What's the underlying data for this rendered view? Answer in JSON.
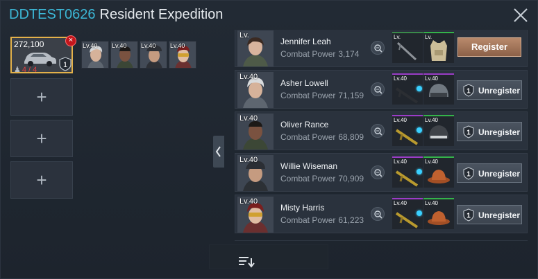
{
  "title": {
    "code": "DDTEST0626",
    "name": "Resident Expedition"
  },
  "squad": {
    "active": {
      "power": "272,100",
      "count": "4 / 4",
      "tier": "1"
    },
    "members": [
      {
        "level": "Lv.40"
      },
      {
        "level": "Lv.40"
      },
      {
        "level": "Lv.40"
      },
      {
        "level": "Lv.40"
      }
    ],
    "empty_slots": 3
  },
  "list": {
    "power_label": "Combat Power",
    "rows": [
      {
        "level": "Lv.",
        "name": "Jennifer Leah",
        "power": "3,174",
        "weapon_level": "Lv.",
        "gear_level": "Lv.",
        "action": "Register"
      },
      {
        "level": "Lv.40",
        "name": "Asher Lowell",
        "power": "71,159",
        "weapon_level": "Lv.40",
        "gear_level": "Lv.40",
        "action": "Unregister",
        "tier": "1"
      },
      {
        "level": "Lv.40",
        "name": "Oliver Rance",
        "power": "68,809",
        "weapon_level": "Lv.40",
        "gear_level": "Lv.40",
        "action": "Unregister",
        "tier": "1"
      },
      {
        "level": "Lv.40",
        "name": "Willie Wiseman",
        "power": "70,909",
        "weapon_level": "Lv.40",
        "gear_level": "Lv.40",
        "action": "Unregister",
        "tier": "1"
      },
      {
        "level": "Lv.40",
        "name": "Misty Harris",
        "power": "61,223",
        "weapon_level": "Lv.40",
        "gear_level": "Lv.40",
        "action": "Unregister",
        "tier": "1"
      }
    ]
  },
  "colors": {
    "accent": "#3cb7d6",
    "register": "#a67757",
    "weapon_rarity": "#9b3cc7",
    "gear_rarity": "#34b34a",
    "danger": "#c4161c",
    "slot_border": "#e3b14a"
  },
  "icons": {
    "close": "close-icon",
    "remove": "remove-icon",
    "car": "car-icon",
    "person": "person-icon",
    "shield": "shield-icon",
    "magnify": "magnify-icon",
    "sort": "sort-icon",
    "collapse": "chevron-left-icon"
  }
}
